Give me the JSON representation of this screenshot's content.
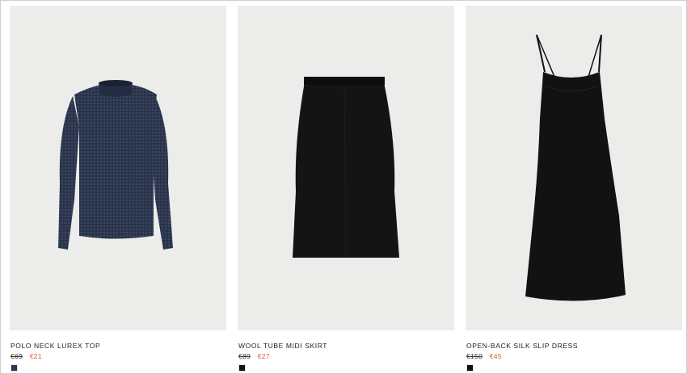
{
  "products": [
    {
      "name": "POLO NECK LUREX TOP",
      "original_price": "€69",
      "sale_price": "€21",
      "swatch_color": "#2b3550",
      "image_icon": "lurex-top-image"
    },
    {
      "name": "WOOL TUBE MIDI SKIRT",
      "original_price": "€89",
      "sale_price": "€27",
      "swatch_color": "#111111",
      "image_icon": "tube-skirt-image"
    },
    {
      "name": "OPEN-BACK SILK SLIP DRESS",
      "original_price": "€150",
      "sale_price": "€45",
      "swatch_color": "#111111",
      "image_icon": "slip-dress-image"
    }
  ],
  "colors": {
    "sale": "#e05a33",
    "image_background": "#ececea"
  }
}
